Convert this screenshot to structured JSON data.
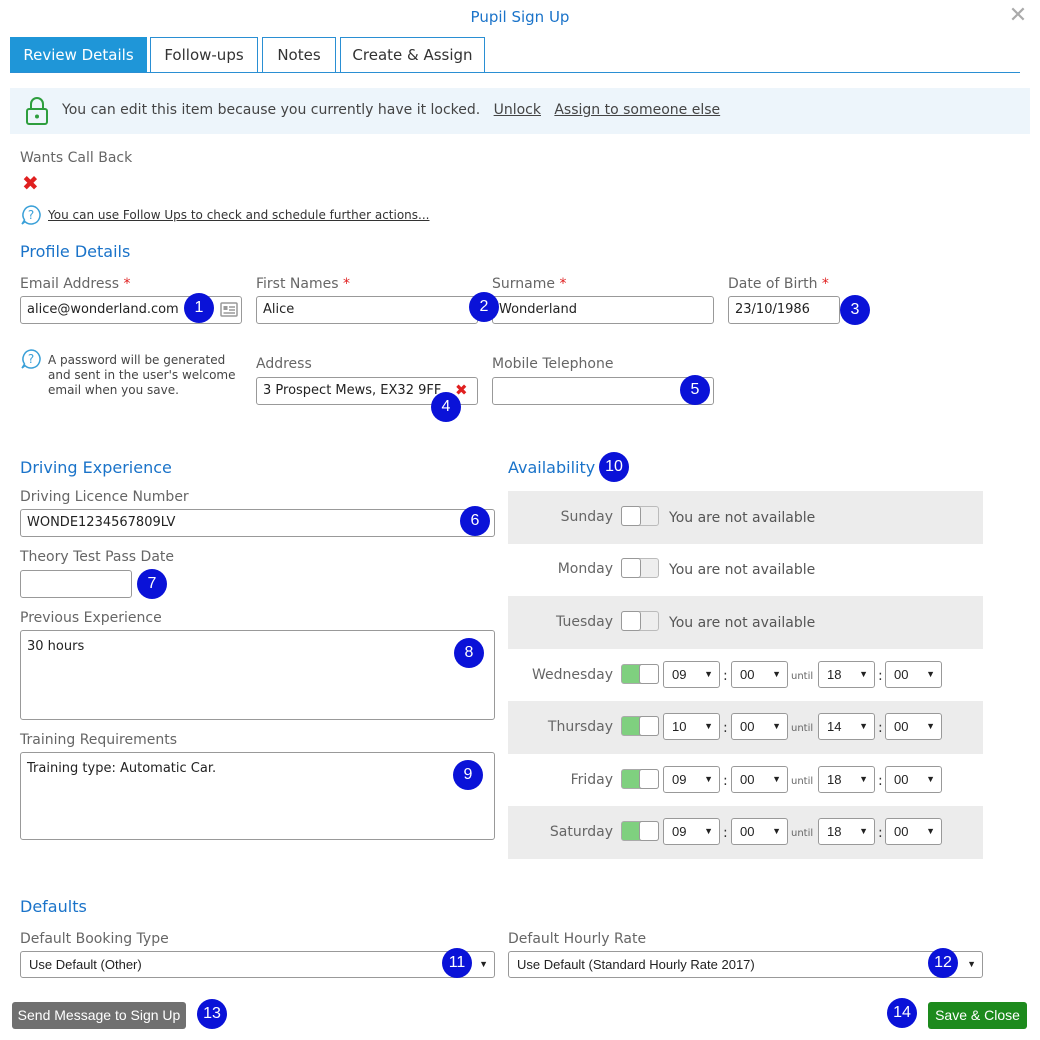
{
  "window": {
    "title": "Pupil Sign Up",
    "close_icon": "close-icon"
  },
  "tabs": [
    {
      "label": "Review Details",
      "active": true
    },
    {
      "label": "Follow-ups",
      "active": false
    },
    {
      "label": "Notes",
      "active": false
    },
    {
      "label": "Create & Assign",
      "active": false
    }
  ],
  "lock_bar": {
    "message": "You can edit this item because you currently have it locked.",
    "unlock": "Unlock",
    "assign": "Assign to someone else",
    "icon": "lock-icon"
  },
  "call_back": {
    "label": "Wants Call Back",
    "value_icon": "cross-icon"
  },
  "follow_up_hint": "You can use Follow Ups to check and schedule further actions...",
  "profile": {
    "heading": "Profile Details",
    "email_label": "Email Address",
    "email_value": "alice@wonderland.com",
    "first_label": "First Names",
    "first_value": "Alice",
    "surname_label": "Surname",
    "surname_value": "Wonderland",
    "dob_label": "Date of Birth",
    "dob_value": "23/10/1986",
    "required_mark": "*",
    "password_hint": "A password will be generated and sent in the user's welcome email when you save.",
    "address_label": "Address",
    "address_value": "3 Prospect Mews, EX32 9FF",
    "mobile_label": "Mobile Telephone",
    "mobile_value": ""
  },
  "driving": {
    "heading": "Driving Experience",
    "licence_label": "Driving Licence Number",
    "licence_value": "WONDE1234567809LV",
    "theory_label": "Theory Test Pass Date",
    "theory_value": "",
    "prev_label": "Previous Experience",
    "prev_value": "30 hours",
    "training_label": "Training Requirements",
    "training_value": "Training type: Automatic Car."
  },
  "availability": {
    "heading": "Availability",
    "until": "until",
    "not_available": "You are not available",
    "days": [
      {
        "day": "Sunday",
        "available": false
      },
      {
        "day": "Monday",
        "available": false
      },
      {
        "day": "Tuesday",
        "available": false
      },
      {
        "day": "Wednesday",
        "available": true,
        "from_h": "09",
        "from_m": "00",
        "to_h": "18",
        "to_m": "00"
      },
      {
        "day": "Thursday",
        "available": true,
        "from_h": "10",
        "from_m": "00",
        "to_h": "14",
        "to_m": "00"
      },
      {
        "day": "Friday",
        "available": true,
        "from_h": "09",
        "from_m": "00",
        "to_h": "18",
        "to_m": "00"
      },
      {
        "day": "Saturday",
        "available": true,
        "from_h": "09",
        "from_m": "00",
        "to_h": "18",
        "to_m": "00"
      }
    ]
  },
  "defaults": {
    "heading": "Defaults",
    "booking_label": "Default Booking Type",
    "booking_value": "Use Default (Other)",
    "rate_label": "Default Hourly Rate",
    "rate_value": "Use Default (Standard Hourly Rate 2017)"
  },
  "buttons": {
    "send": "Send Message to Sign Up",
    "save": "Save & Close"
  },
  "markers": [
    "1",
    "2",
    "3",
    "4",
    "5",
    "6",
    "7",
    "8",
    "9",
    "10",
    "11",
    "12",
    "13",
    "14"
  ],
  "colors": {
    "accent": "#1f96d8",
    "heading": "#1a73c9",
    "badge": "#0a12d8",
    "save": "#1d8a1d",
    "send": "#707070",
    "toggle_on": "#7fd07f"
  }
}
